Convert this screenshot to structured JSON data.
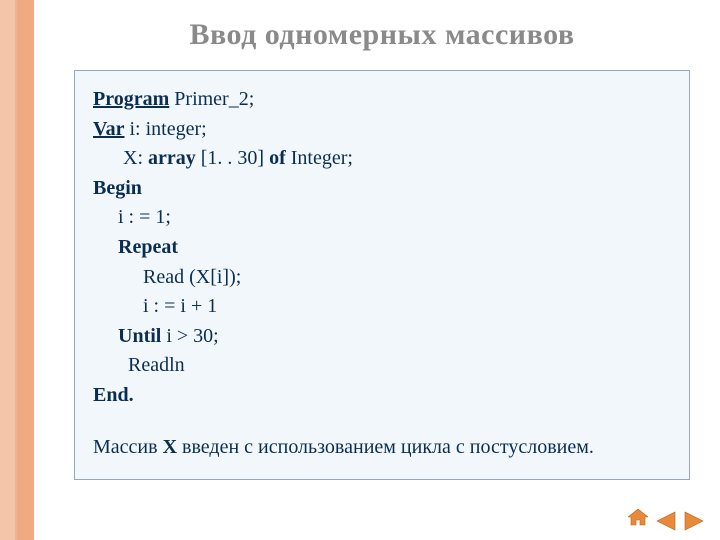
{
  "title": "Ввод одномерных массивов",
  "code": {
    "l1_kw": "Program",
    "l1_rest": " Primer_2;",
    "l2_kw": "Var",
    "l2_rest": " i: integer;",
    "l3_pre": "      X: ",
    "l3_kw1": "array",
    "l3_mid": " [1. . 30] ",
    "l3_kw2": "of",
    "l3_rest": " Integer;",
    "l4_kw": "Begin",
    "l5": "     i : = 1;",
    "l6_pre": "     ",
    "l6_kw": "Repeat",
    "l7": "          Read (X[i]);",
    "l8": "          i : = i + 1",
    "l9_pre": "     ",
    "l9_kw": "Until",
    "l9_rest": " i > 30;",
    "l10": "       Readln",
    "l11_kw": "End."
  },
  "note_pre": "Массив ",
  "note_bold": "X",
  "note_post": " введен с использованием цикла с постусловием.",
  "nav": {
    "home": "home",
    "prev": "prev",
    "next": "next"
  }
}
